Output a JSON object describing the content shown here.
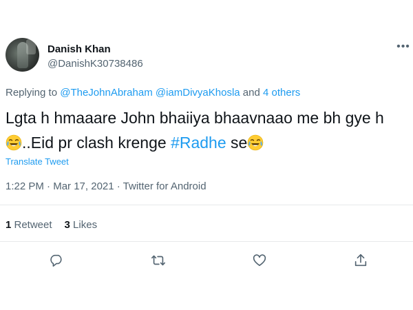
{
  "author": {
    "name": "Danish Khan",
    "handle": "@DanishK30738486"
  },
  "menu_icon": "more-horizontal-icon",
  "replying": {
    "prefix": "Replying to ",
    "mention1": "@TheJohnAbraham",
    "mention2": "@iamDivyaKhosla",
    "and": " and ",
    "others": "4 others"
  },
  "tweet": {
    "line1": "Lgta h hmaaare John bhaiiya bhaavnaao me bh gye h",
    "part2": "..Eid pr clash krenge ",
    "hashtag": "#Radhe",
    "part3": " se",
    "emoji": "face-with-tears-of-joy"
  },
  "translate_label": "Translate Tweet",
  "meta": {
    "time": "1:22 PM",
    "sep1": " · ",
    "date": "Mar 17, 2021",
    "sep2": " · ",
    "source": "Twitter for Android"
  },
  "stats": {
    "retweets_count": "1",
    "retweets_label": " Retweet",
    "likes_count": "3",
    "likes_label": " Likes"
  },
  "actions": [
    {
      "icon": "reply-icon"
    },
    {
      "icon": "retweet-icon"
    },
    {
      "icon": "like-icon"
    },
    {
      "icon": "share-icon"
    }
  ],
  "colors": {
    "link": "#1d9bf0",
    "secondary_text": "#536471",
    "primary_text": "#0f1419",
    "divider": "#e7e9ea"
  }
}
